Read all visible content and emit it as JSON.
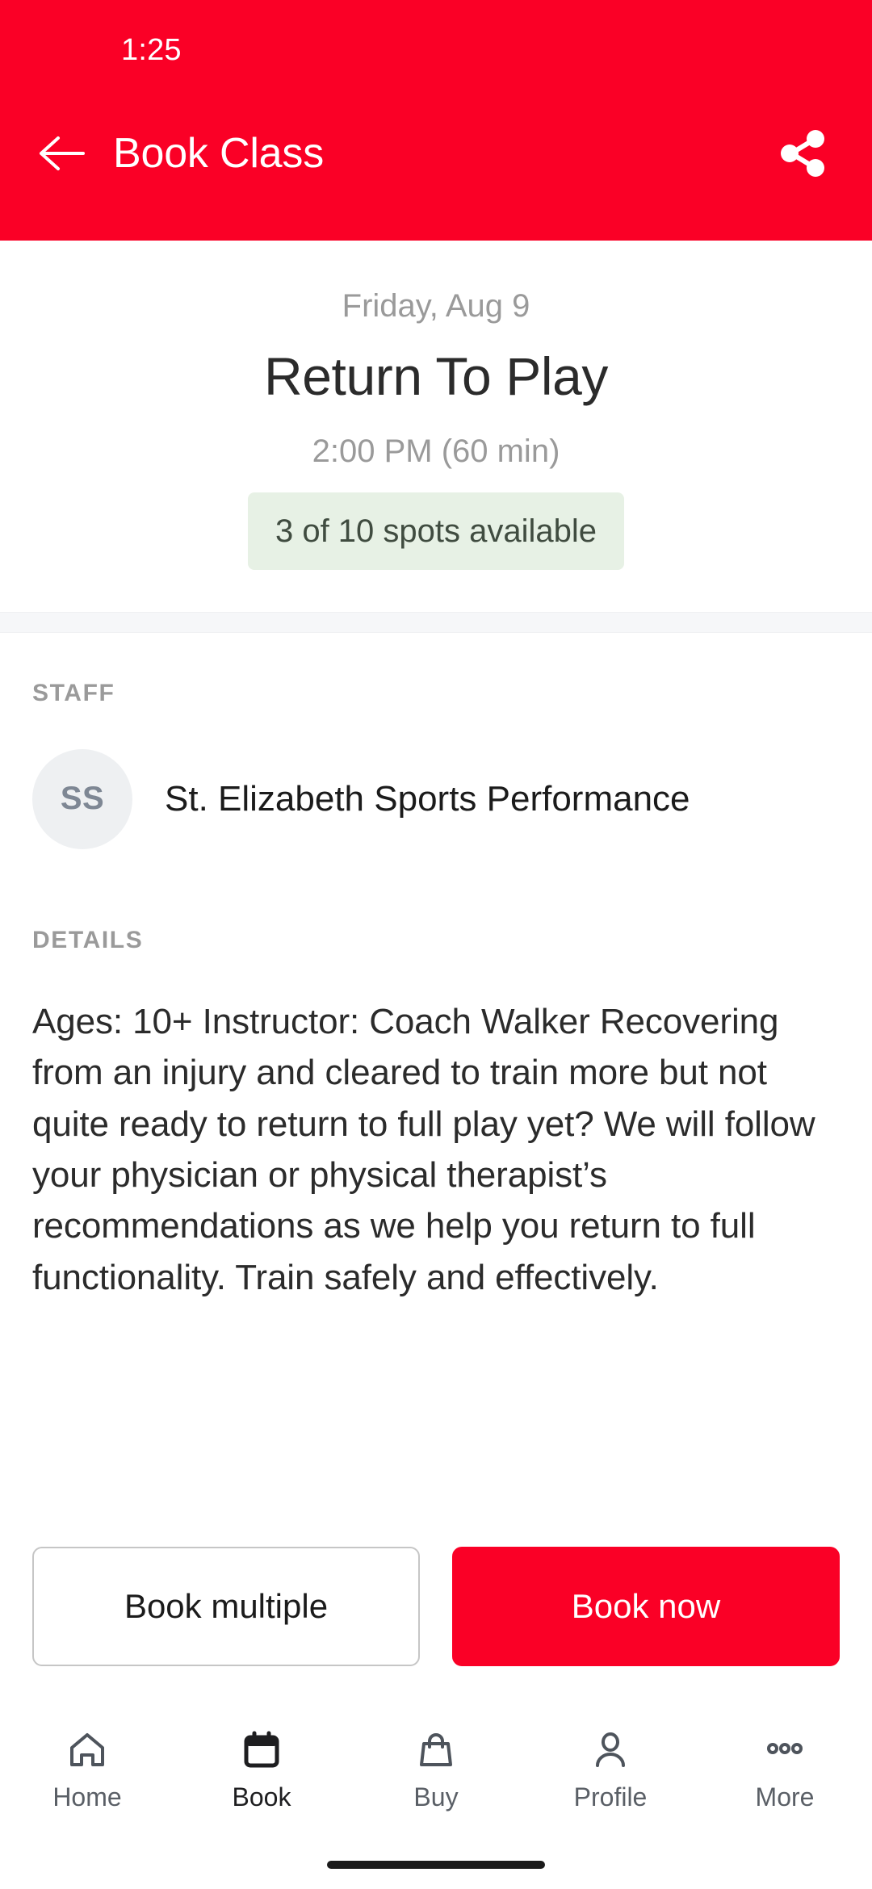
{
  "status_bar": {
    "time": "1:25"
  },
  "appbar": {
    "title": "Book Class",
    "back_icon": "arrow-left-icon",
    "share_icon": "share-icon",
    "background_color": "#FA0026"
  },
  "class": {
    "date": "Friday, Aug 9",
    "name": "Return To Play",
    "time": "2:00 PM (60 min)",
    "availability": "3 of 10 spots available",
    "availability_bg_color": "#E7F1E5",
    "availability_text_color": "#404C40"
  },
  "staff": {
    "label": "STAFF",
    "avatar_initials": "SS",
    "name": "St. Elizabeth Sports Performance"
  },
  "details": {
    "label": "DETAILS",
    "text": "Ages: 10+ Instructor: Coach Walker Recovering from an injury and cleared to train more but not quite ready to return to full play yet? We will follow your physician or physical therapist’s recommendations as we help you return to full functionality. Train safely and effectively."
  },
  "actions": {
    "secondary_label": "Book multiple",
    "primary_label": "Book now",
    "primary_color": "#FA0026"
  },
  "bottom_nav": {
    "items": [
      {
        "label": "Home",
        "icon": "home-icon",
        "active": false
      },
      {
        "label": "Book",
        "icon": "calendar-icon",
        "active": true
      },
      {
        "label": "Buy",
        "icon": "bag-icon",
        "active": false
      },
      {
        "label": "Profile",
        "icon": "person-icon",
        "active": false
      },
      {
        "label": "More",
        "icon": "more-dots-icon",
        "active": false
      }
    ]
  }
}
